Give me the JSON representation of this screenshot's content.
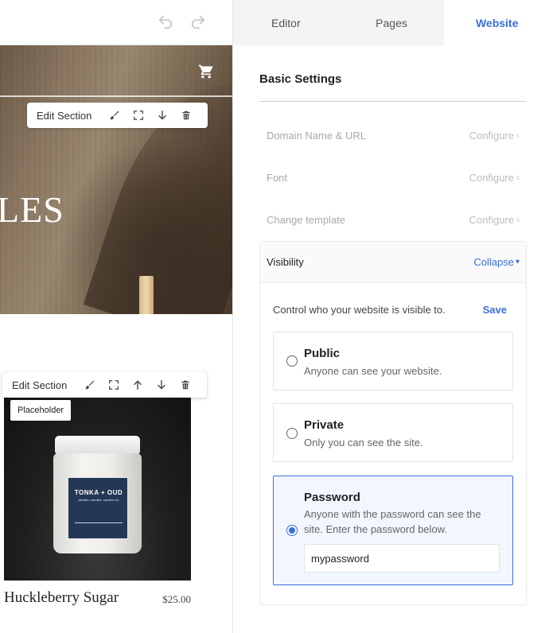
{
  "undo_bar": {
    "undo_icon": "undo-icon",
    "redo_icon": "redo-icon"
  },
  "hero": {
    "title_fragment": "LES",
    "cart_icon": "shopping-cart-icon"
  },
  "edit_toolbar_1": {
    "label": "Edit Section",
    "icons": [
      "paintbrush-icon",
      "expand-icon",
      "arrow-down-icon",
      "trash-icon"
    ]
  },
  "edit_toolbar_2": {
    "label": "Edit Section",
    "icons": [
      "paintbrush-icon",
      "expand-icon",
      "arrow-up-icon",
      "arrow-down-icon",
      "trash-icon"
    ]
  },
  "product": {
    "badge": "Placeholder",
    "jar_label_title": "TONKA + OUD",
    "jar_label_sub": "candles, candles, candles co.",
    "name": "Huckleberry Sugar",
    "price": "$25.00"
  },
  "tabs": [
    {
      "label": "Editor",
      "active": false
    },
    {
      "label": "Pages",
      "active": false
    },
    {
      "label": "Website",
      "active": true
    }
  ],
  "basic_settings": {
    "title": "Basic Settings",
    "rows": [
      {
        "label": "Domain Name & URL",
        "action": "Configure"
      },
      {
        "label": "Font",
        "action": "Configure"
      },
      {
        "label": "Change template",
        "action": "Configure"
      }
    ]
  },
  "visibility": {
    "title": "Visibility",
    "collapse_label": "Collapse",
    "description": "Control who your website is visible to.",
    "save_label": "Save",
    "options": [
      {
        "title": "Public",
        "description": "Anyone can see your website.",
        "selected": false
      },
      {
        "title": "Private",
        "description": "Only you can see the site.",
        "selected": false
      },
      {
        "title": "Password",
        "description": "Anyone with the password can see the site. Enter the password below.",
        "selected": true
      }
    ],
    "password_value": "mypassword"
  },
  "colors": {
    "accent": "#3b6fe0",
    "selected_bg": "#f2f6fe"
  }
}
